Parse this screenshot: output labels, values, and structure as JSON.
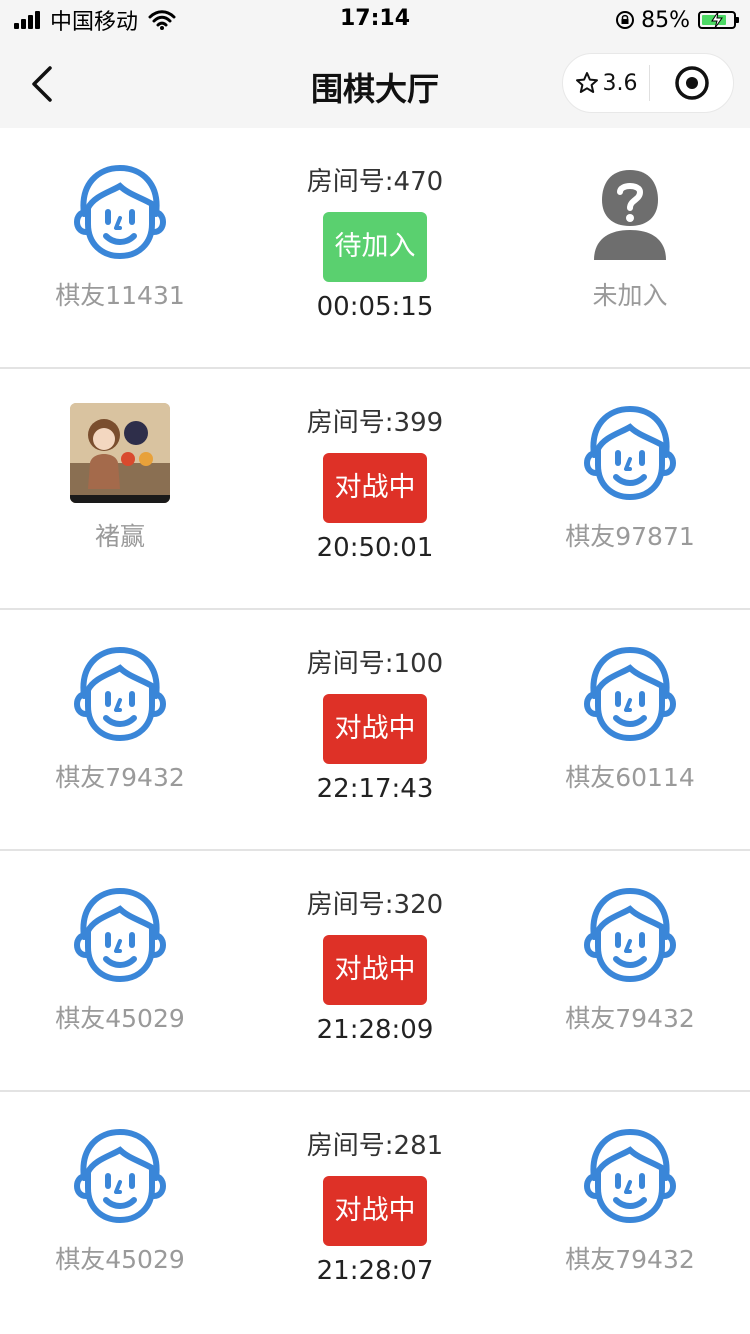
{
  "status_bar": {
    "carrier": "中国移动",
    "time": "17:14",
    "battery": "85%"
  },
  "nav": {
    "title": "围棋大厅",
    "rating": "3.6"
  },
  "rooms": [
    {
      "room_label": "房间号:470",
      "status": "待加入",
      "status_type": "waiting",
      "timer": "00:05:15",
      "left_player": "棋友11431",
      "right_player": "未加入"
    },
    {
      "room_label": "房间号:399",
      "status": "对战中",
      "status_type": "playing",
      "timer": "20:50:01",
      "left_player": "褚赢",
      "right_player": "棋友97871"
    },
    {
      "room_label": "房间号:100",
      "status": "对战中",
      "status_type": "playing",
      "timer": "22:17:43",
      "left_player": "棋友79432",
      "right_player": "棋友60114"
    },
    {
      "room_label": "房间号:320",
      "status": "对战中",
      "status_type": "playing",
      "timer": "21:28:09",
      "left_player": "棋友45029",
      "right_player": "棋友79432"
    },
    {
      "room_label": "房间号:281",
      "status": "对战中",
      "status_type": "playing",
      "timer": "21:28:07",
      "left_player": "棋友45029",
      "right_player": "棋友79432"
    }
  ],
  "colors": {
    "waiting": "#5ad06f",
    "playing": "#de3127",
    "avatar_blue": "#3a86d8"
  }
}
